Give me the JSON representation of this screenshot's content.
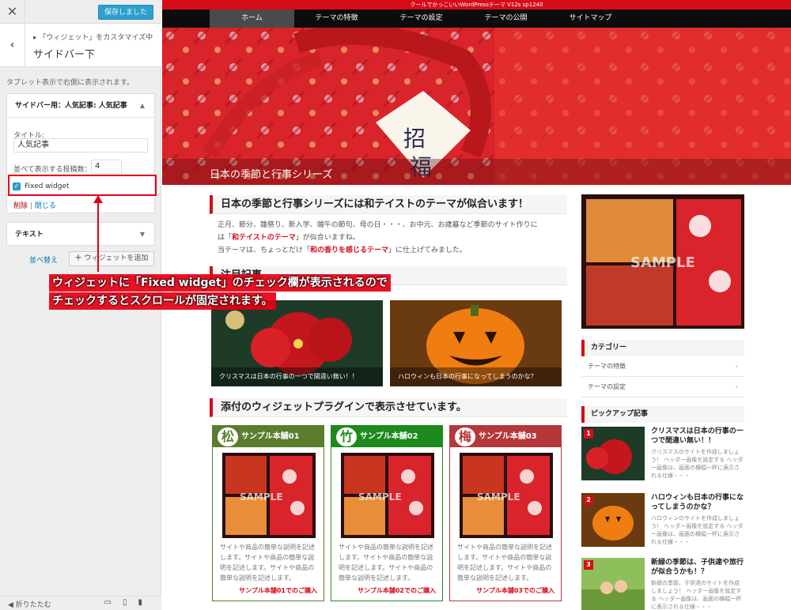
{
  "customizer": {
    "close_icon": "close-icon",
    "save_label": "保存しました",
    "back_icon": "chevron-left-icon",
    "breadcrumb": "「ウィジェット」をカスタマイズ中",
    "panel_title": "サイドバー下",
    "description": "タブレット表示で右側に表示されます。",
    "widget1": {
      "title": "サイドバー用：人気記事: 人気記事",
      "title_label": "タイトル:",
      "title_value": "人気記事",
      "count_label": "並べて表示する投稿数：",
      "count_value": "4",
      "fixed_label": "Fixed widget",
      "fixed_checked": true,
      "delete_label": "削除",
      "separator": "|",
      "close_label": "閉じる"
    },
    "widget2": {
      "title": "テキスト"
    },
    "reorder_label": "並べ替え",
    "add_widget_label": "ウィジェットを追加",
    "collapse_label": "折りたたむ",
    "devices": [
      "desktop-icon",
      "tablet-icon",
      "mobile-icon"
    ]
  },
  "annotation": {
    "line1": "ウィジェットに「Fixed widget」のチェック欄が表示されるので",
    "line2": "チェックするとスクロールが固定されます。",
    "color": "#e60012"
  },
  "site": {
    "top_bar": "クールでかっこいいWordPressテーマ V12s sp1240",
    "nav": [
      "ホーム",
      "テーマの特徴",
      "テーマの設定",
      "テーマの公開",
      "サイトマップ"
    ],
    "hero_caption": "日本の季節と行事シリーズ",
    "section1": {
      "heading": "日本の季節と行事シリーズには和テイストのテーマが似合います！",
      "p1a": "正月、節分、雛祭り、新入学、端午の節句、母の日・・・、お中元、お歳暮など季節のサイト作りに",
      "p1b_pre": "は「",
      "p1b_red": "和テイストのテーマ",
      "p1b_post": "」が似合いますね。",
      "p2_pre": "当テーマは、ちょっとだけ「",
      "p2_red": "和の香りを感じるテーマ",
      "p2_post": "」に仕上げてみました。"
    },
    "section2_heading": "注目記事",
    "featured": [
      {
        "caption": "クリスマスは日本の行事の一つで間違い無い！！"
      },
      {
        "caption": "ハロウィンも日本の行事になってしまうのかな？"
      }
    ],
    "section3_heading": "添付のウィジェットプラグインで表示させています。",
    "products": [
      {
        "badge": "松",
        "title": "サンプル本舗01",
        "text": "サイトや商品の簡単な説明を記述します。サイトや商品の簡単な説明を記述します。サイトや商品の簡単な説明を記述します。",
        "link": "サンプル本舗01でのご購入",
        "color": "#5a7d2e"
      },
      {
        "badge": "竹",
        "title": "サンプル本舗02",
        "text": "サイトや商品の簡単な説明を記述します。サイトや商品の簡単な説明を記述します。サイトや商品の簡単な説明を記述します。",
        "link": "サンプル本舗02でのご購入",
        "color": "#1c8a1c"
      },
      {
        "badge": "梅",
        "title": "サンプル本舗03",
        "text": "サイトや商品の簡単な説明を記述します。サイトや商品の簡単な説明を記述します。サイトや商品の簡単な説明を記述します。",
        "link": "サンプル本舗03でのご購入",
        "color": "#b5373a"
      }
    ],
    "sample_watermark": "SAMPLE",
    "sidebar": {
      "category_title": "カテゴリー",
      "categories": [
        "テーマの特徴",
        "テーマの設定"
      ],
      "pickup_title": "ピックアップ記事",
      "pickups": [
        {
          "num": "1",
          "title": "クリスマスは日本の行事の一つで間違い無い！！",
          "text": "クリスマスのサイトを作成しましょう！ ヘッダー画像を設定する ヘッダー画像は、画面の横幅一杯に表示される仕様・・・"
        },
        {
          "num": "2",
          "title": "ハロウィンも日本の行事になってしまうのかな？",
          "text": "ハロウィンのサイトを作成しましょう！ ヘッダー画像を設定する ヘッダー画像は、画面の横幅一杯に表示される仕様・・・"
        },
        {
          "num": "3",
          "title": "新緑の季節は、子供達や旅行が似合うかも！？",
          "text": "新緑の季節、子供達のサイトを作成しましょう！ ヘッダー画像を設定する ヘッダー画像は、画面の横幅一杯に表示される仕様・・・"
        }
      ]
    }
  }
}
